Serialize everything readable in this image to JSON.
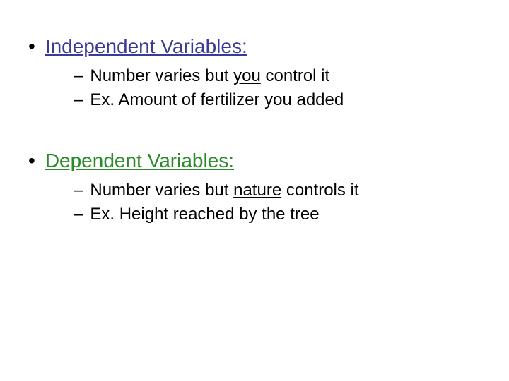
{
  "group1": {
    "heading_text": "Independent Variables",
    "heading_suffix": ":",
    "sub1_prefix": "Number varies but ",
    "sub1_underlined": "you",
    "sub1_suffix": " control it",
    "sub2": "Ex. Amount of fertilizer you added"
  },
  "group2": {
    "heading_text": "Dependent Variables",
    "heading_suffix": ":",
    "sub1_prefix": "Number varies but ",
    "sub1_underlined": "nature",
    "sub1_suffix": " controls it",
    "sub2": "Ex. Height reached by the tree"
  }
}
